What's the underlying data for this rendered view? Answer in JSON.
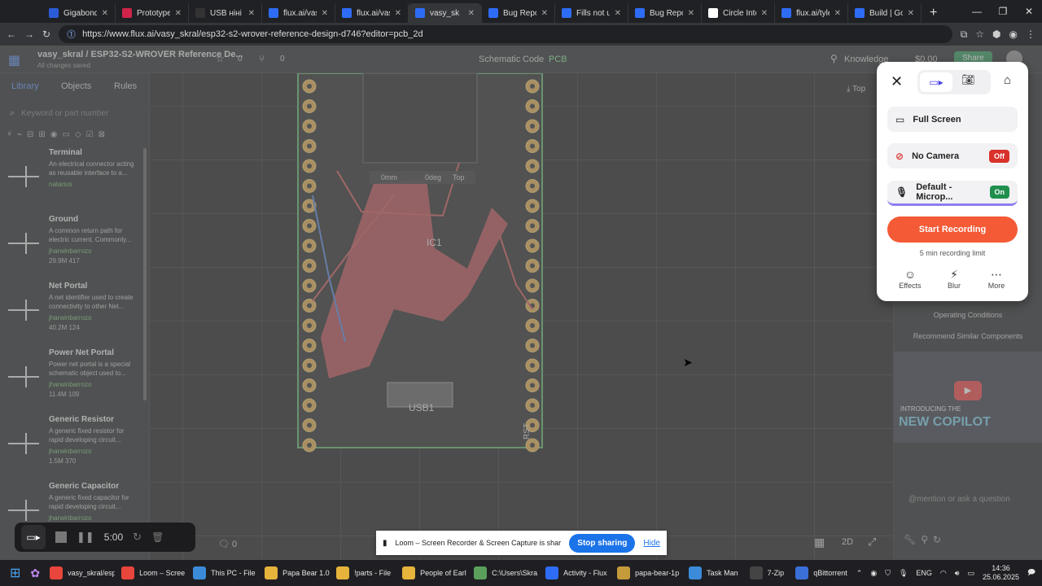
{
  "tabs": [
    {
      "label": "Gigabond -",
      "color": "#2b5bd7"
    },
    {
      "label": "Prototypes",
      "color": "#d0244b"
    },
    {
      "label": "USB ніні до",
      "color": "#333333"
    },
    {
      "label": "flux.ai/vasy",
      "color": "#2e6cf6"
    },
    {
      "label": "flux.ai/vasy",
      "color": "#2e6cf6"
    },
    {
      "label": "vasy_sk",
      "color": "#2e6cf6"
    },
    {
      "label": "Bug Report",
      "color": "#2e6cf6"
    },
    {
      "label": "Fills not up",
      "color": "#2e6cf6"
    },
    {
      "label": "Bug Report",
      "color": "#2e6cf6"
    },
    {
      "label": "Circle Inter",
      "color": "#ffffff"
    },
    {
      "label": "flux.ai/tyler",
      "color": "#2e6cf6"
    },
    {
      "label": "Build | Goo",
      "color": "#2e6cf6"
    }
  ],
  "address": {
    "url": "https://www.flux.ai/vasy_skral/esp32-s2-wrover-reference-design-d746?editor=pcb_2d"
  },
  "app": {
    "project": "vasy_skral / ESP32-S2-WROVER Reference De...",
    "saved": "All changes saved",
    "stars": "0",
    "forks": "0",
    "modes": [
      "Schematic",
      "Code",
      "PCB"
    ],
    "knowledge": "Knowledge",
    "price": "$0.00",
    "share": "Share",
    "top_label": "Top"
  },
  "library": {
    "tabs": [
      "Library",
      "Objects",
      "Rules"
    ],
    "search_placeholder": "Keyword or part number",
    "components": [
      {
        "name": "Terminal",
        "desc": "An electrical connector acting as reusable interface to a...",
        "author": "natarius",
        "stats": ""
      },
      {
        "name": "Ground",
        "desc": "A common return path for electric current. Commonly...",
        "author": "jharwinbarrozo",
        "stats": "29.9M   417"
      },
      {
        "name": "Net Portal",
        "desc": "A net identifier used to create connectivity to other Net...",
        "author": "jharwinbarrozo",
        "stats": "40.2M   124"
      },
      {
        "name": "Power Net Portal",
        "desc": "Power net portal is a special schematic object used to...",
        "author": "jharwinbarrozo",
        "stats": "11.4M   109"
      },
      {
        "name": "Generic Resistor",
        "desc": "A generic fixed resistor for rapid developing circuit...",
        "author": "jharwinbarrozo",
        "stats": "1.5M   370"
      },
      {
        "name": "Generic Capacitor",
        "desc": "A generic fixed capacitor for rapid developing circuit...",
        "author": "jharwinbarrozo",
        "stats": ""
      }
    ]
  },
  "canvas": {
    "hud": [
      "0mm",
      "0deg",
      "Top"
    ],
    "bottom_count": "0",
    "view_mode": "2D"
  },
  "rightpanel": {
    "operating": "Operating Conditions",
    "recommend": "Recommend Similar Components",
    "promo_small": "INTRODUCING THE",
    "promo_big": "NEW COPILOT",
    "chat_placeholder": "@mention or ask a question"
  },
  "loom": {
    "full_screen": "Full Screen",
    "no_camera": "No Camera",
    "camera_state": "Off",
    "mic": "Default - Microp...",
    "mic_state": "On",
    "start": "Start Recording",
    "limit": "5 min recording limit",
    "effects": "Effects",
    "blur": "Blur",
    "more": "More",
    "timer": "5:00",
    "sharing": "Loom – Screen Recorder & Screen Capture is sharing your screen.",
    "stop": "Stop sharing",
    "hide": "Hide"
  },
  "taskbar": {
    "items": [
      {
        "label": "vasy_skral/esp",
        "color": "#e8453c"
      },
      {
        "label": "Loom – Scree",
        "color": "#e8453c"
      },
      {
        "label": "This PC - File",
        "color": "#3b8bd8"
      },
      {
        "label": "Papa Bear 1.0",
        "color": "#e6b33b"
      },
      {
        "label": "!parts - File",
        "color": "#e6b33b"
      },
      {
        "label": "People of Earl",
        "color": "#e6b33b"
      },
      {
        "label": "C:\\Users\\Skra",
        "color": "#5aa05a"
      },
      {
        "label": "Activity - Flux",
        "color": "#2e6cf6"
      },
      {
        "label": "papa-bear-1p",
        "color": "#c59a3b"
      },
      {
        "label": "Task Man",
        "color": "#3b8bd8"
      },
      {
        "label": "7-Zip",
        "color": "#444444"
      },
      {
        "label": "qBittorrent",
        "color": "#3b6fd8"
      }
    ],
    "lang": "ENG",
    "time": "14:36",
    "date": "25.06.2025"
  },
  "colors": {
    "accent": "#f45a35",
    "off": "#d8322b",
    "on": "#1f8f4e",
    "link": "#1a73e8"
  }
}
